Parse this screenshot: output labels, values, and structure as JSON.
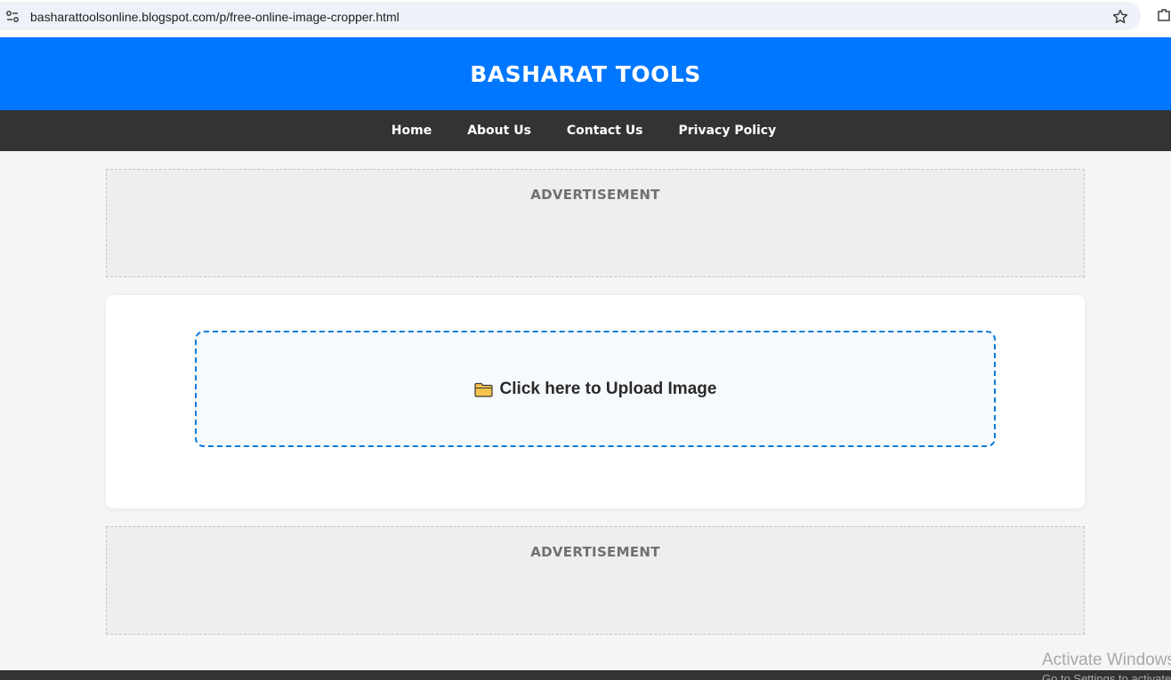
{
  "browser": {
    "url": "basharattoolsonline.blogspot.com/p/free-online-image-cropper.html",
    "icons": [
      "site-info-icon",
      "bookmark-star-icon",
      "extensions-icon"
    ]
  },
  "header": {
    "title": "BASHARAT TOOLS",
    "color": "#0077ff"
  },
  "nav": {
    "items": [
      {
        "label": "Home"
      },
      {
        "label": "About Us"
      },
      {
        "label": "Contact Us"
      },
      {
        "label": "Privacy Policy"
      }
    ]
  },
  "ads": {
    "top_label": "ADVERTISEMENT",
    "bottom_label": "ADVERTISEMENT"
  },
  "upload": {
    "icon": "folder-icon",
    "label": "Click here to Upload Image",
    "border_color": "#0a7ad8"
  },
  "system_overlay": {
    "title": "Activate Windows",
    "subtitle": "Go to Settings to activate Windows."
  }
}
